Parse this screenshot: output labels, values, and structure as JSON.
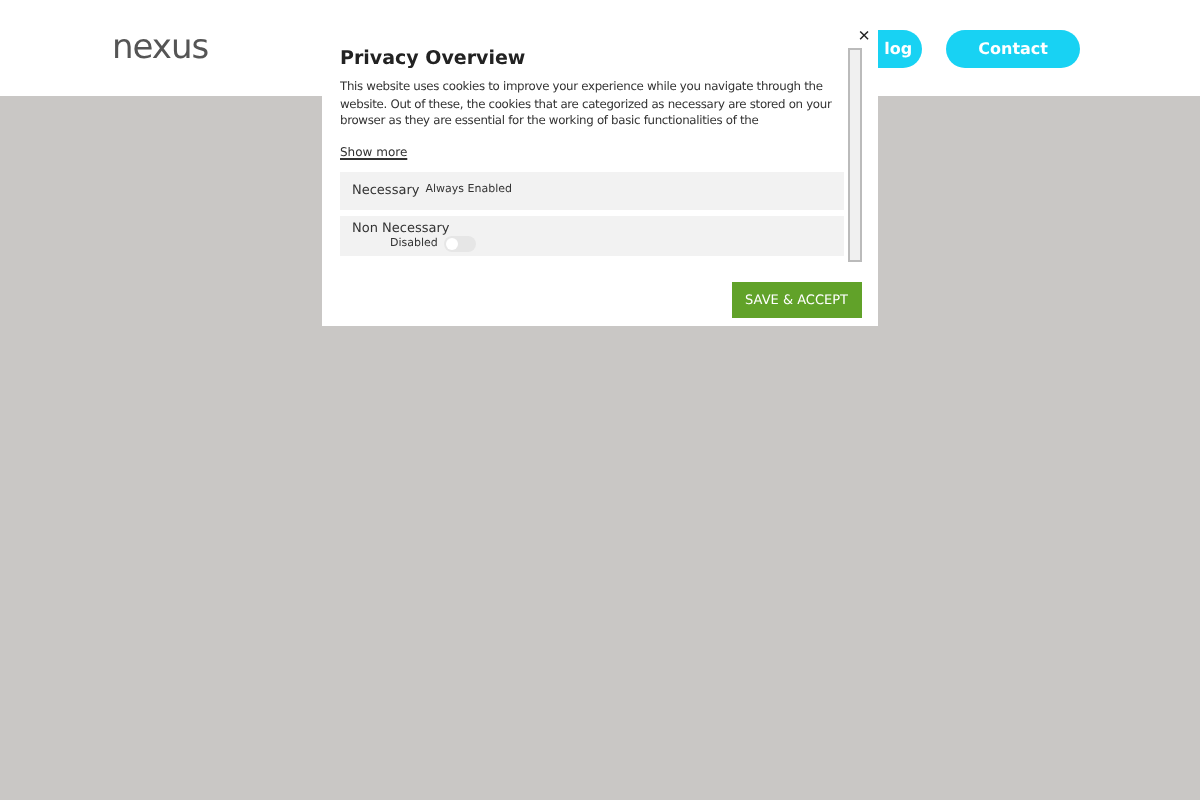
{
  "header": {
    "logo": "nexus",
    "buttons": [
      {
        "label": "log"
      },
      {
        "label": "Contact"
      }
    ]
  },
  "dialog": {
    "close": "×",
    "title": "Privacy Overview",
    "body": "This website uses cookies to improve your experience while you navigate through the website. Out of these, the cookies that are categorized as necessary are stored on your browser as they are essential for the working of basic functionalities of the",
    "show_more": "Show more",
    "categories": [
      {
        "kind": "fixed",
        "name": "Necessary",
        "status": "Always Enabled"
      },
      {
        "kind": "toggle",
        "name": "Non Necessary",
        "status": "Disabled",
        "on": false
      }
    ],
    "accept": "SAVE & ACCEPT"
  }
}
